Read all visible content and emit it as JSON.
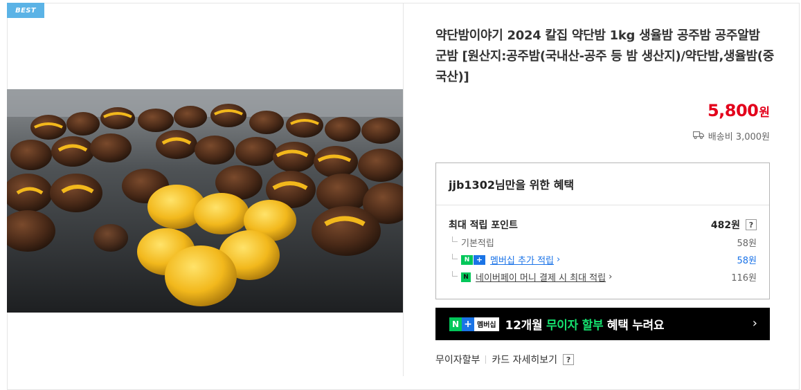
{
  "badge": "BEST",
  "product": {
    "title": "약단밤이야기 2024 칼집 약단밤 1kg 생율밤 공주밤 공주알밤 군밤 [원산지:공주밤(국내산-공주 등 밤 생산지)/약단밤,생율밤(중국산)]",
    "price_number": "5,800",
    "price_unit": "원",
    "shipping": "배송비 3,000원"
  },
  "benefit": {
    "header": "jjb1302님만을 위한 혜택",
    "max_points_label": "최대 적립 포인트",
    "max_points_value": "482원",
    "help_mark": "?",
    "rows": [
      {
        "label": "기본적립",
        "value": "58원"
      },
      {
        "label": "멤버십 추가 적립",
        "value": "58원"
      },
      {
        "label": "네이버페이 머니 결제 시 최대 적립",
        "value": "116원"
      }
    ],
    "npay_icon_text": "N",
    "plus_icon_text": "+",
    "n_icon_text": "N"
  },
  "banner": {
    "n_text": "N",
    "plus_text": "+",
    "membership_text": "멤버십",
    "text_before": "12개월 ",
    "text_highlight": "무이자 할부",
    "text_after": " 혜택 누려요",
    "arrow": "›"
  },
  "footer_links": {
    "installment": "무이자할부",
    "card_details": "카드 자세히보기",
    "help_mark": "?"
  },
  "colors": {
    "price": "#e3001b",
    "badge": "#5bb3e6",
    "link": "#1a73e8",
    "naver_green": "#03c75a",
    "highlight_green": "#15e36f"
  },
  "icons": {
    "shipping": "truck-icon",
    "arrow": "chevron-right-icon"
  }
}
